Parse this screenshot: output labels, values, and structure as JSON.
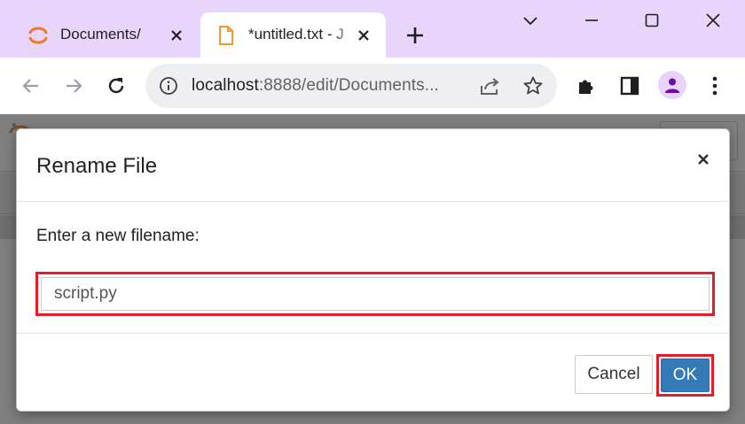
{
  "browser": {
    "tabs": [
      {
        "title": "Documents/",
        "favicon": "jupyter-icon",
        "active": false
      },
      {
        "title": "*untitled.txt - J",
        "favicon": "file-icon",
        "active": true
      }
    ],
    "address_bar": {
      "host": "localhost",
      "rest": ":8888/edit/Documents..."
    },
    "colors": {
      "tab_strip": "#e8d5fb",
      "accent": "#6a0dad"
    }
  },
  "dialog": {
    "title": "Rename File",
    "close_symbol": "×",
    "prompt": "Enter a new filename:",
    "filename_value": "script.py",
    "cancel_label": "Cancel",
    "ok_label": "OK",
    "colors": {
      "primary": "#337ab7",
      "highlight": "#e51d2a"
    }
  }
}
